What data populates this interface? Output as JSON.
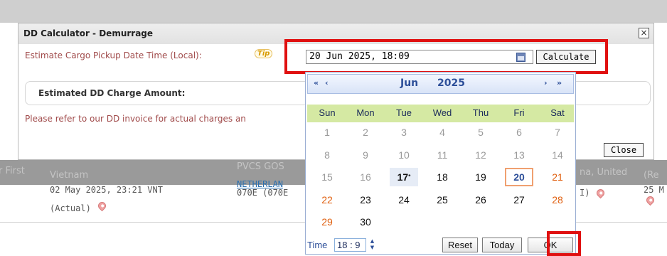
{
  "dialog": {
    "title": "DD Calculator - Demurrage",
    "pickup_label": "Estimate Cargo Pickup Date Time (Local):",
    "tip_label": "Tip",
    "date_value": "20 Jun 2025, 18:09",
    "calculate_label": "Calculate",
    "charge_label": "Estimated DD Charge Amount:",
    "note_text": "Please refer to our DD invoice for actual charges an",
    "close_label": "Close",
    "close_x": "×"
  },
  "background": {
    "row1_left": "Vietnam",
    "row1_left_prefix": "r First",
    "row1_mid": "PVCS GOS",
    "row1_right": "na, United",
    "row1_far": "(Re",
    "date_text": "02 May 2025, 23:21 VNT",
    "actual_text": "(Actual)",
    "link_text": "NETHERLAN",
    "voyage_text": "070E (070E",
    "right_frag": "I)",
    "far_date": "25 M"
  },
  "calendar": {
    "month": "Jun",
    "year": "2025",
    "nav_prev_year": "«",
    "nav_prev_month": "‹",
    "nav_next_month": "›",
    "nav_next_year": "»",
    "weekdays": [
      "Sun",
      "Mon",
      "Tue",
      "Wed",
      "Thu",
      "Fri",
      "Sat"
    ],
    "weeks": [
      [
        "1",
        "2",
        "3",
        "4",
        "5",
        "6",
        "7"
      ],
      [
        "8",
        "9",
        "10",
        "11",
        "12",
        "13",
        "14"
      ],
      [
        "15",
        "16",
        "17",
        "18",
        "19",
        "20",
        "21"
      ],
      [
        "22",
        "23",
        "24",
        "25",
        "26",
        "27",
        "28"
      ],
      [
        "29",
        "30"
      ]
    ],
    "today_marker": "*",
    "time_label": "Time",
    "time_value": "18 :  9",
    "reset_label": "Reset",
    "today_label": "Today",
    "ok_label": "OK"
  }
}
